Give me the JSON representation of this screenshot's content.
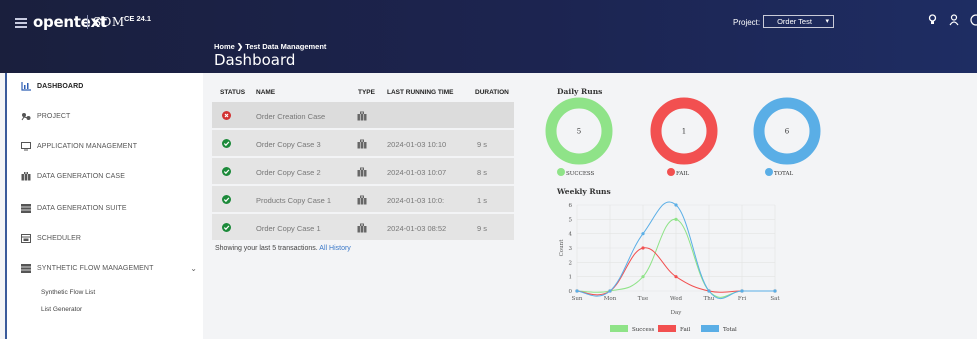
{
  "header": {
    "logo": "opentext",
    "product": "SDM",
    "version": "CE 24.1",
    "breadcrumb": "Home ❯ Test Data Management",
    "title": "Dashboard",
    "project_label": "Project:",
    "project_value": "Order Test"
  },
  "sidebar": {
    "items": [
      {
        "label": "DASHBOARD",
        "icon": "bar-chart-icon"
      },
      {
        "label": "PROJECT",
        "icon": "network-icon"
      },
      {
        "label": "APPLICATION MANAGEMENT",
        "icon": "monitor-icon"
      },
      {
        "label": "DATA GENERATION CASE",
        "icon": "briefcase-icon"
      },
      {
        "label": "DATA GENERATION SUITE",
        "icon": "suite-icon"
      },
      {
        "label": "SCHEDULER",
        "icon": "calendar-icon"
      },
      {
        "label": "SYNTHETIC FLOW MANAGEMENT",
        "icon": "flow-icon"
      }
    ],
    "subitems": [
      "Synthetic Flow List",
      "List Generator"
    ]
  },
  "table": {
    "columns": [
      "STATUS",
      "NAME",
      "TYPE",
      "LAST RUNNING TIME",
      "DURATION"
    ],
    "rows": [
      {
        "status": "fail",
        "name": "Order Creation Case",
        "time": "",
        "duration": ""
      },
      {
        "status": "success",
        "name": "Order Copy Case 3",
        "time": "2024-01-03 10:10",
        "duration": "9 s"
      },
      {
        "status": "success",
        "name": "Order Copy Case 2",
        "time": "2024-01-03 10:07",
        "duration": "8 s"
      },
      {
        "status": "success",
        "name": "Products Copy Case 1",
        "time": "2024-01-03 10:0:",
        "duration": "1 s"
      },
      {
        "status": "success",
        "name": "Order Copy Case 1",
        "time": "2024-01-03 08:52",
        "duration": "9 s"
      }
    ],
    "footnote": "Showing your last 5 transactions.",
    "history_link": "All History"
  },
  "chart_data": [
    {
      "type": "pie",
      "title": "Daily Runs",
      "categories": [
        "SUCCESS",
        "FAIL",
        "TOTAL"
      ],
      "values": [
        5,
        1,
        6
      ],
      "colors": [
        "#8fe388",
        "#f25050",
        "#5aaee6"
      ]
    },
    {
      "type": "line",
      "title": "Weekly Runs",
      "xlabel": "Day",
      "ylabel": "Count",
      "categories": [
        "Sun",
        "Mon",
        "Tue",
        "Wed",
        "Thu",
        "Fri",
        "Sat"
      ],
      "ylim": [
        0,
        6
      ],
      "yticks": [
        0,
        1,
        2,
        3,
        4,
        5,
        6
      ],
      "series": [
        {
          "name": "Success",
          "values": [
            0,
            0,
            1,
            5,
            0,
            0,
            0
          ],
          "color": "#8fe388"
        },
        {
          "name": "Fail",
          "values": [
            0,
            0,
            3,
            1,
            0,
            0,
            0
          ],
          "color": "#f25050"
        },
        {
          "name": "Total",
          "values": [
            0,
            0,
            4,
            6,
            0,
            0,
            0
          ],
          "color": "#5aaee6"
        }
      ]
    }
  ]
}
